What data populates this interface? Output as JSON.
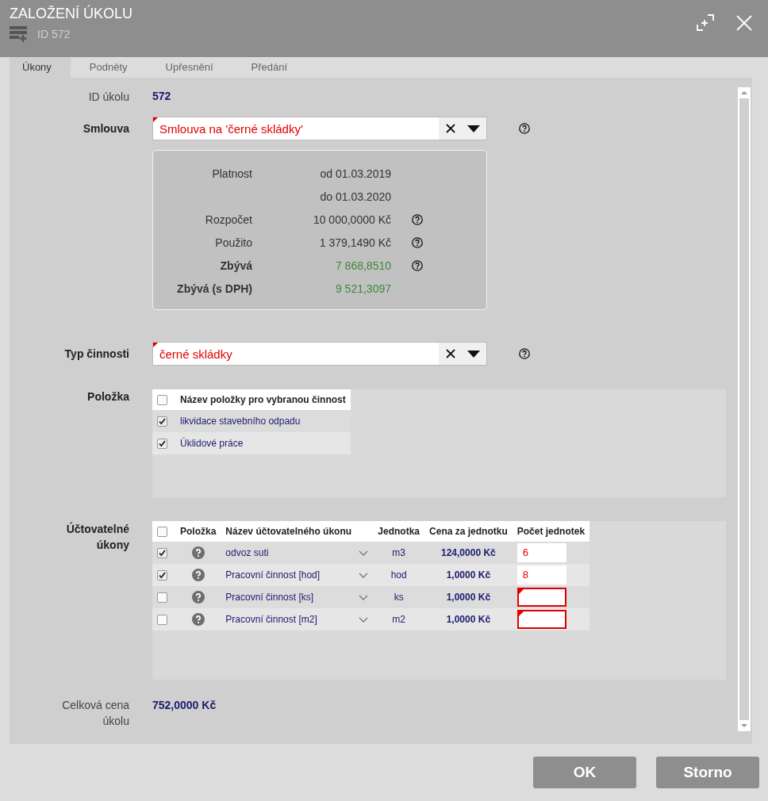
{
  "window": {
    "title": "ZALOŽENÍ ÚKOLU",
    "subtitle": "ID 572"
  },
  "tabs": [
    {
      "label": "Úkony",
      "selected": true
    },
    {
      "label": "Podněty",
      "selected": false
    },
    {
      "label": "Upřesnění",
      "selected": false
    },
    {
      "label": "Předání",
      "selected": false
    }
  ],
  "task_id": {
    "label": "ID úkolu",
    "value": "572"
  },
  "contract": {
    "label": "Smlouva",
    "value": "Smlouva na 'černé skládky'",
    "summary": [
      {
        "label": "Platnost",
        "value": "od 01.03.2019",
        "kind": "plain",
        "help": false
      },
      {
        "value": "do 01.03.2020",
        "kind": "plain",
        "help": false
      },
      {
        "label": "Rozpočet",
        "value": "10 000,0000 Kč",
        "kind": "plain",
        "help": true
      },
      {
        "label": "Použito",
        "value": "1 379,1490 Kč",
        "kind": "plain",
        "help": true
      },
      {
        "label": "Zbývá",
        "value": "7 868,8510",
        "kind": "highlight",
        "help": true
      },
      {
        "label": "Zbývá (s DPH)",
        "value": "9 521,3097",
        "kind": "highlight",
        "help": false
      }
    ]
  },
  "activity_type": {
    "label": "Typ činnosti",
    "value": "černé skládky"
  },
  "items": {
    "label": "Položka",
    "header": "Název položky pro vybranou činnost",
    "header_checked": false,
    "rows": [
      {
        "label": "likvidace stavebního odpadu",
        "checked": true
      },
      {
        "label": "Úklidové práce",
        "checked": true
      }
    ]
  },
  "billable": {
    "label": "Účtovatelné úkony",
    "header_checked": false,
    "columns": [
      "Položka",
      "Název účtovatelného úkonu",
      "Jednotka",
      "Cena za jednotku",
      "Počet jednotek"
    ],
    "rows": [
      {
        "checked": true,
        "name": "odvoz suti",
        "unit": "m3",
        "price": "124,0000 Kč",
        "count": "6",
        "invalid": false
      },
      {
        "checked": true,
        "name": "Pracovní činnost [hod]",
        "unit": "hod",
        "price": "1,0000 Kč",
        "count": "8",
        "invalid": false
      },
      {
        "checked": false,
        "name": "Pracovní činnost [ks]",
        "unit": "ks",
        "price": "1,0000 Kč",
        "invalid": true
      },
      {
        "checked": false,
        "name": "Pracovní činnost [m2]",
        "unit": "m2",
        "price": "1,0000 Kč",
        "invalid": true
      }
    ]
  },
  "total": {
    "label": "Celková cena úkolu",
    "value": "752,0000 Kč"
  },
  "buttons": [
    "OK",
    "Storno"
  ]
}
